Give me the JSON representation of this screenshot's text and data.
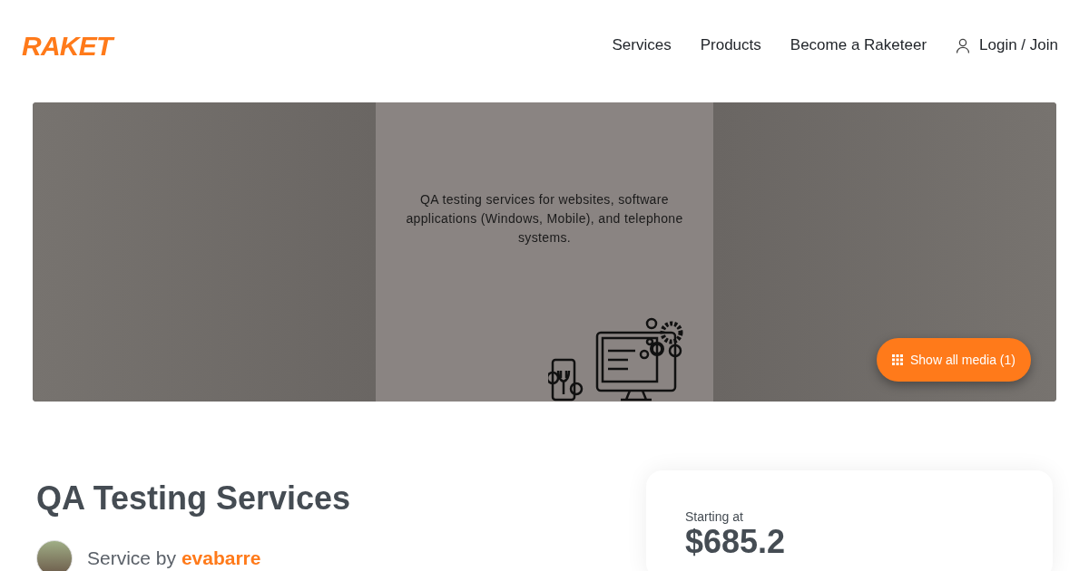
{
  "logo": {
    "text": "RAKET"
  },
  "nav": [
    {
      "label": "Services",
      "kind": "link"
    },
    {
      "label": "Products",
      "kind": "link"
    },
    {
      "label": "Become a Raketeer",
      "kind": "link"
    },
    {
      "label": "Login / Join",
      "kind": "account"
    }
  ],
  "media": {
    "image_text": "QA testing services for websites, software applications (Windows, Mobile), and telephone systems.",
    "show_all_button": "Show all media (1)"
  },
  "service": {
    "title": "QA Testing Services",
    "by_label": "Service by",
    "seller": "evabarre"
  },
  "price_card": {
    "label": "Starting at",
    "price": "$685.2"
  }
}
